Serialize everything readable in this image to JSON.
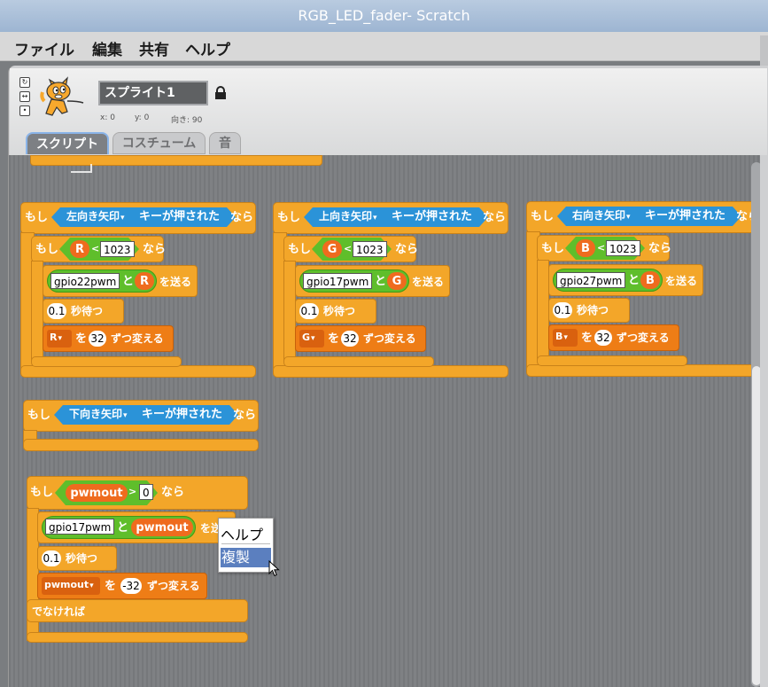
{
  "window": {
    "title": "RGB_LED_fader- Scratch"
  },
  "menu": [
    "ファイル",
    "編集",
    "共有",
    "ヘルプ"
  ],
  "sprite": {
    "name": "スプライト1",
    "x_label": "x: 0",
    "y_label": "y: 0",
    "direction_label": "向き: 90"
  },
  "tabs": [
    "スクリプト",
    "コスチューム",
    "音"
  ],
  "colors": {
    "control": "#f3a629",
    "sensing": "#2b93d8",
    "operator": "#5fbe2b",
    "data": "#ee7d16",
    "more_blocks": "#f3a629",
    "variable_reporter": "#ef6b1e"
  },
  "scripts": [
    {
      "if_label": "もし",
      "key": "左向き矢印",
      "key_suffix": "キーが押された",
      "then": "なら",
      "var": "R",
      "lt": "<",
      "limit": "1023",
      "gpio": "gpio22pwm",
      "to": "と",
      "send": "を送る",
      "wait_val": "0.1",
      "wait_label": "秒待つ",
      "step_var": "R",
      "step_to": "を",
      "step_val": "32",
      "step_label": "ずつ変える"
    },
    {
      "if_label": "もし",
      "key": "上向き矢印",
      "key_suffix": "キーが押された",
      "then": "なら",
      "var": "G",
      "lt": "<",
      "limit": "1023",
      "gpio": "gpio17pwm",
      "to": "と",
      "send": "を送る",
      "wait_val": "0.1",
      "wait_label": "秒待つ",
      "step_var": "G",
      "step_to": "を",
      "step_val": "32",
      "step_label": "ずつ変える"
    },
    {
      "if_label": "もし",
      "key": "右向き矢印",
      "key_suffix": "キーが押された",
      "then": "なら",
      "var": "B",
      "lt": "<",
      "limit": "1023",
      "gpio": "gpio27pwm",
      "to": "と",
      "send": "を送る",
      "wait_val": "0.1",
      "wait_label": "秒待つ",
      "step_var": "B",
      "step_to": "を",
      "step_val": "32",
      "step_label": "ずつ変える"
    }
  ],
  "down_script": {
    "if_label": "もし",
    "key": "下向き矢印",
    "key_suffix": "キーが押された",
    "then": "なら"
  },
  "pwm_script": {
    "if_label": "もし",
    "var": "pwmout",
    "gt": ">",
    "limit": "0",
    "then": "なら",
    "gpio": "gpio17pwm",
    "to": "と",
    "send": "を送る",
    "wait_val": "0.1",
    "wait_label": "秒待つ",
    "step_var": "pwmout",
    "step_to": "を",
    "step_val": "-32",
    "step_label": "ずつ変える",
    "else_label": "でなければ"
  },
  "context_menu": {
    "help": "ヘルプ",
    "duplicate": "複製"
  }
}
